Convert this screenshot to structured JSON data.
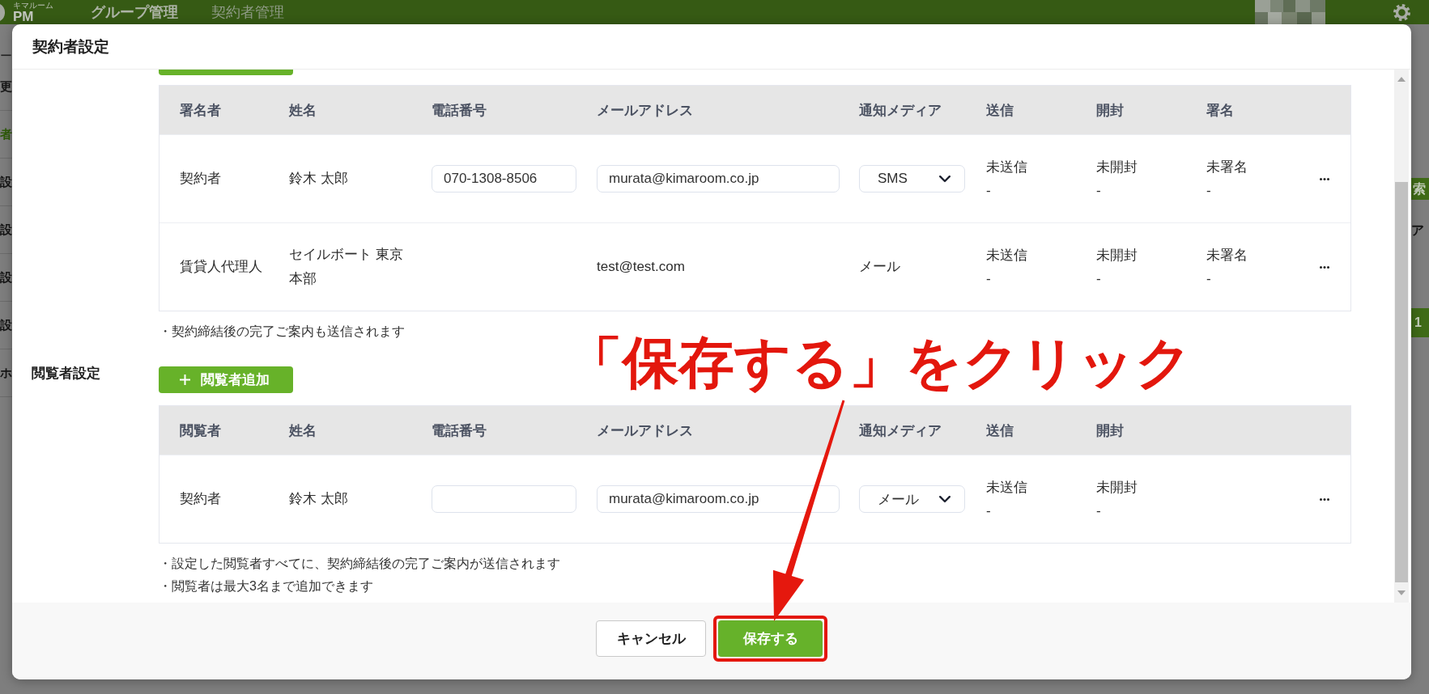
{
  "background_page": {
    "header": {
      "brand_caption": "キマルーム",
      "brand_name": "PM",
      "nav": [
        {
          "label": "グループ管理",
          "selected": true
        },
        {
          "label": "契約者管理",
          "selected": false
        }
      ]
    },
    "breadcrumb_fragment": "ー",
    "sidebar_items": [
      {
        "label": "更",
        "selected": false
      },
      {
        "label": "者",
        "selected": true
      },
      {
        "label": "設",
        "selected": false
      },
      {
        "label": "設",
        "selected": false
      },
      {
        "label": "設",
        "selected": false
      },
      {
        "label": "設",
        "selected": false
      },
      {
        "label": "ホ",
        "selected": false
      }
    ],
    "right_edge": {
      "button_fragment": "索",
      "text_fragment": "ア",
      "page_fragment": "1"
    }
  },
  "modal": {
    "title": "契約者設定",
    "signer_section": {
      "table": {
        "columns": [
          "署名者",
          "姓名",
          "電話番号",
          "メールアドレス",
          "通知メディア",
          "送信",
          "開封",
          "署名"
        ],
        "rows": [
          {
            "role": "契約者",
            "name": "鈴木 太郎",
            "phone": {
              "kind": "input",
              "value": "070-1308-8506"
            },
            "email": {
              "kind": "input",
              "value": "murata@kimaroom.co.jp"
            },
            "media": {
              "kind": "select",
              "value": "SMS"
            },
            "sent": {
              "status": "未送信",
              "detail": "-"
            },
            "opened": {
              "status": "未開封",
              "detail": "-"
            },
            "signed": {
              "status": "未署名",
              "detail": "-"
            }
          },
          {
            "role": "賃貸人代理人",
            "name": "セイルボート 東京本部",
            "email": {
              "kind": "text",
              "value": "test@test.com"
            },
            "media": {
              "kind": "text",
              "value": "メール"
            },
            "sent": {
              "status": "未送信",
              "detail": "-"
            },
            "opened": {
              "status": "未開封",
              "detail": "-"
            },
            "signed": {
              "status": "未署名",
              "detail": "-"
            }
          }
        ]
      },
      "notes": [
        "・契約締結後の完了ご案内も送信されます"
      ]
    },
    "viewer_section": {
      "label": "閲覧者設定",
      "add_button": "閲覧者追加",
      "table": {
        "columns": [
          "閲覧者",
          "姓名",
          "電話番号",
          "メールアドレス",
          "通知メディア",
          "送信",
          "開封"
        ],
        "rows": [
          {
            "role": "契約者",
            "name": "鈴木 太郎",
            "phone": {
              "kind": "input"
            },
            "email": {
              "kind": "input",
              "value": "murata@kimaroom.co.jp"
            },
            "media": {
              "kind": "select",
              "value": "メール"
            },
            "sent": {
              "status": "未送信",
              "detail": "-"
            },
            "opened": {
              "status": "未開封",
              "detail": "-"
            }
          }
        ]
      },
      "notes": [
        "・設定した閲覧者すべてに、契約締結後の完了ご案内が送信されます",
        "・閲覧者は最大3名まで追加できます"
      ]
    },
    "buttons": [
      {
        "label": "キャンセル",
        "kind": "secondary",
        "highlighted": false
      },
      {
        "label": "保存する",
        "kind": "primary",
        "highlighted": true
      }
    ]
  },
  "annotation": {
    "text": "「保存する」をクリック"
  }
}
